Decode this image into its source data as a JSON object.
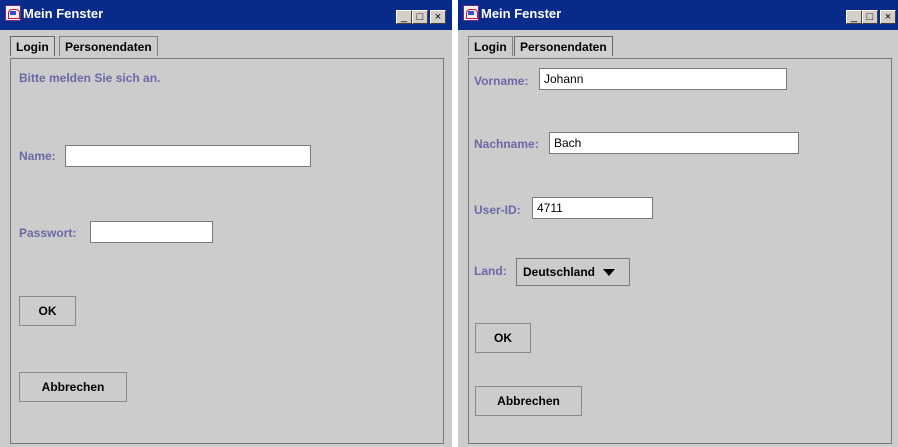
{
  "windows": [
    {
      "title": "Mein Fenster",
      "tabs": [
        {
          "label": "Login",
          "active": true
        },
        {
          "label": "Personendaten",
          "active": false
        }
      ],
      "panel": {
        "message": "Bitte melden Sie sich an.",
        "name_label": "Name:",
        "name_value": "",
        "password_label": "Passwort:",
        "password_value": "",
        "ok_label": "OK",
        "cancel_label": "Abbrechen"
      }
    },
    {
      "title": "Mein Fenster",
      "tabs": [
        {
          "label": "Login",
          "active": false
        },
        {
          "label": "Personendaten",
          "active": true
        }
      ],
      "panel": {
        "vorname_label": "Vorname:",
        "vorname_value": "Johann",
        "nachname_label": "Nachname:",
        "nachname_value": "Bach",
        "userid_label": "User-ID:",
        "userid_value": "4711",
        "land_label": "Land:",
        "land_value": "Deutschland",
        "ok_label": "OK",
        "cancel_label": "Abbrechen"
      }
    }
  ],
  "window_controls": {
    "minimize": "_",
    "maximize": "□",
    "close": "×"
  },
  "colors": {
    "titlebar": "#082a8a",
    "label": "#6b68a6",
    "background": "#cccccc"
  }
}
